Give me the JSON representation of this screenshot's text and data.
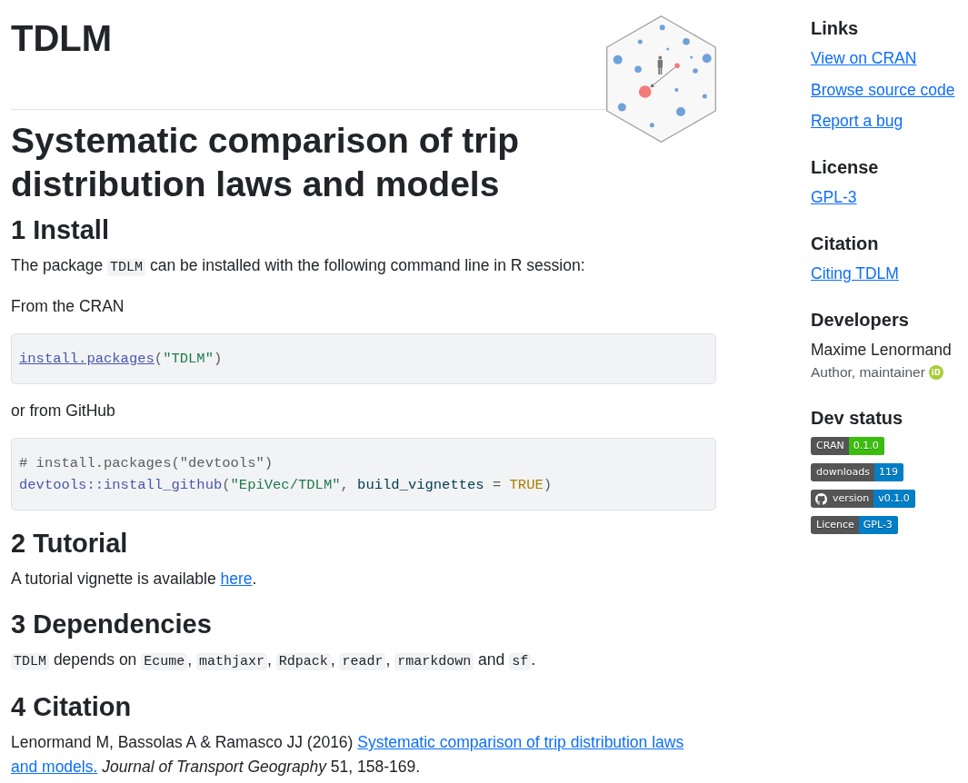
{
  "header": {
    "title": "TDLM"
  },
  "main": {
    "title": "Systematic comparison of trip distribution laws and models",
    "sections": [
      {
        "heading": "1 Install",
        "blocks": [
          {
            "kind": "paragraph",
            "parts": [
              {
                "kind": "text",
                "text": "The package "
              },
              {
                "kind": "code",
                "text": "TDLM"
              },
              {
                "kind": "text",
                "text": " can be installed with the following command line in R session:"
              }
            ]
          },
          {
            "kind": "paragraph",
            "parts": [
              {
                "kind": "text",
                "text": "From the CRAN"
              }
            ]
          },
          {
            "kind": "code_block",
            "lines": [
              [
                {
                  "kind": "link",
                  "text": "install.packages"
                },
                {
                  "kind": "plain",
                  "text": "("
                },
                {
                  "kind": "string",
                  "text": "\"TDLM\""
                },
                {
                  "kind": "plain",
                  "text": ")"
                }
              ]
            ]
          },
          {
            "kind": "paragraph",
            "parts": [
              {
                "kind": "text",
                "text": "or from GitHub"
              }
            ]
          },
          {
            "kind": "code_block",
            "lines": [
              [
                {
                  "kind": "comment",
                  "text": "# install.packages(\"devtools\")"
                }
              ],
              [
                {
                  "kind": "function",
                  "text": "devtools::install_github"
                },
                {
                  "kind": "plain",
                  "text": "("
                },
                {
                  "kind": "string",
                  "text": "\"EpiVec/TDLM\""
                },
                {
                  "kind": "plain",
                  "text": ", "
                },
                {
                  "kind": "argument",
                  "text": "build_vignettes"
                },
                {
                  "kind": "operator",
                  "text": " = "
                },
                {
                  "kind": "constant",
                  "text": "TRUE"
                },
                {
                  "kind": "plain",
                  "text": ")"
                }
              ]
            ]
          }
        ]
      },
      {
        "heading": "2 Tutorial",
        "blocks": [
          {
            "kind": "paragraph",
            "parts": [
              {
                "kind": "text",
                "text": "A tutorial vignette is available "
              },
              {
                "kind": "link",
                "text": "here"
              },
              {
                "kind": "text",
                "text": "."
              }
            ]
          }
        ]
      },
      {
        "heading": "3 Dependencies",
        "blocks": [
          {
            "kind": "paragraph",
            "parts": [
              {
                "kind": "code",
                "text": "TDLM"
              },
              {
                "kind": "text",
                "text": " depends on "
              },
              {
                "kind": "code",
                "text": "Ecume"
              },
              {
                "kind": "text",
                "text": ", "
              },
              {
                "kind": "code",
                "text": "mathjaxr"
              },
              {
                "kind": "text",
                "text": ", "
              },
              {
                "kind": "code",
                "text": "Rdpack"
              },
              {
                "kind": "text",
                "text": ", "
              },
              {
                "kind": "code",
                "text": "readr"
              },
              {
                "kind": "text",
                "text": ", "
              },
              {
                "kind": "code",
                "text": "rmarkdown"
              },
              {
                "kind": "text",
                "text": " and "
              },
              {
                "kind": "code",
                "text": "sf"
              },
              {
                "kind": "text",
                "text": "."
              }
            ]
          }
        ]
      },
      {
        "heading": "4 Citation",
        "blocks": [
          {
            "kind": "paragraph",
            "parts": [
              {
                "kind": "text",
                "text": "Lenormand M, Bassolas A & Ramasco JJ (2016) "
              },
              {
                "kind": "link",
                "text": "Systematic comparison of trip distribution laws "
              },
              {
                "kind": "link",
                "text": "and models."
              },
              {
                "kind": "text",
                "text": " *Journal of Transport Geography* 51, 158-169."
              }
            ]
          }
        ]
      }
    ]
  },
  "sidebar": {
    "sections": [
      {
        "heading": "Links",
        "items": [
          {
            "kind": "link",
            "text": "View on CRAN"
          },
          {
            "kind": "link",
            "text": "Browse source code"
          },
          {
            "kind": "link",
            "text": "Report a bug"
          }
        ]
      },
      {
        "heading": "License",
        "items": [
          {
            "kind": "link",
            "text": "GPL-3"
          }
        ]
      },
      {
        "heading": "Citation",
        "items": [
          {
            "kind": "link",
            "text": "Citing TDLM"
          }
        ]
      },
      {
        "heading": "Developers",
        "items": [
          {
            "kind": "person",
            "name": "Maxime Lenormand",
            "role": "Author, maintainer",
            "id_mark": "iD"
          }
        ]
      },
      {
        "heading": "Dev status",
        "items": [
          {
            "kind": "badge",
            "label": "CRAN",
            "value": "0.1.0",
            "color": "#3bbd0f",
            "logo": false
          },
          {
            "kind": "badge",
            "label": "downloads",
            "value": "119",
            "color": "#007ec6",
            "logo": false
          },
          {
            "kind": "badge",
            "label": "version",
            "value": "v0.1.0",
            "color": "#007ec6",
            "logo": true
          },
          {
            "kind": "badge",
            "label": "Licence",
            "value": "GPL-3",
            "color": "#007ec6",
            "logo": false
          }
        ]
      }
    ]
  }
}
